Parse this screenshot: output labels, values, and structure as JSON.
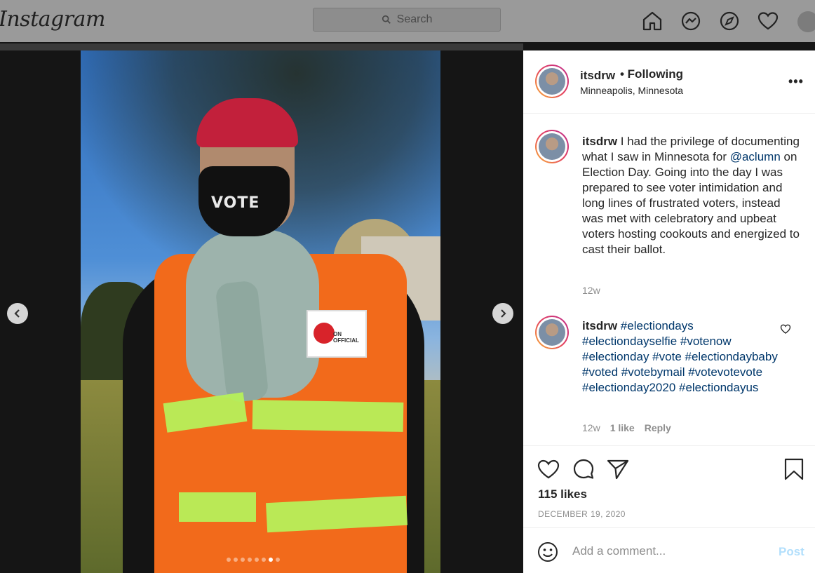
{
  "topbar": {
    "logo": "Instagram",
    "search_placeholder": "Search",
    "icons": [
      "home-icon",
      "messenger-icon",
      "explore-icon",
      "activity-heart-icon",
      "profile-avatar"
    ]
  },
  "carousel": {
    "total_slides": 8,
    "active_slide": 7,
    "mask_text": "VOTE",
    "badge_text": "ON OFFICIAL"
  },
  "post": {
    "username": "itsdrw",
    "follow_status": "• Following",
    "location": "Minneapolis, Minnesota",
    "more": "•••"
  },
  "caption": {
    "username": "itsdrw",
    "text_before": " I had the privilege of documenting what I saw in Minnesota for ",
    "mention": "@aclumn",
    "text_after": " on Election Day. Going into the day I was prepared to see voter intimidation and long lines of frustrated voters, instead was met with celebratory and upbeat voters hosting cookouts and energized to cast their ballot.",
    "time": "12w"
  },
  "comment": {
    "username": "itsdrw",
    "hashtags": "#electiondays #electiondayselfie #votenow #electionday #vote #electiondaybaby #voted #votebymail #votevotevote #electionday2020 #electiondayus",
    "time": "12w",
    "likes": "1 like",
    "reply": "Reply"
  },
  "actions": {
    "likes": "115 likes",
    "date": "DECEMBER 19, 2020"
  },
  "add_comment": {
    "placeholder": "Add a comment...",
    "post_label": "Post"
  },
  "colors": {
    "link": "#00376b",
    "post_disabled": "#b2dffc",
    "muted": "#8e8e8e"
  }
}
